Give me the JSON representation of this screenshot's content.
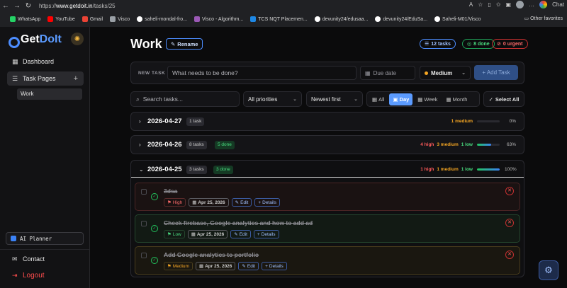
{
  "browser": {
    "url_prefix": "https://",
    "url_host": "www.getdoit.in",
    "url_path": "/tasks/25",
    "chat_label": "Chat",
    "bookmarks": [
      {
        "label": "WhatsApp",
        "color": "#25d366"
      },
      {
        "label": "YouTube",
        "color": "#ff0000"
      },
      {
        "label": "Gmail",
        "color": "#ea4335"
      },
      {
        "label": "Visco",
        "color": "#9aa0a6"
      },
      {
        "label": "saheli-mondal-fro...",
        "color": "#ffffff"
      },
      {
        "label": "Visco - Algorithm...",
        "color": "#9b59b6"
      },
      {
        "label": "TCS NQT Placemen...",
        "color": "#1e88e5"
      },
      {
        "label": "devunity24/edusaa...",
        "color": "#ffffff"
      },
      {
        "label": "devunity24/EduSa...",
        "color": "#ffffff"
      },
      {
        "label": "Saheli-M01/Visco",
        "color": "#ffffff"
      }
    ],
    "other_favorites": "Other favorites"
  },
  "sidebar": {
    "logo_get": "Get",
    "logo_doit": "DoIt",
    "dashboard": "Dashboard",
    "task_pages": "Task Pages",
    "active_page": "Work",
    "ai_planner": "AI Planner",
    "contact": "Contact",
    "logout": "Logout"
  },
  "header": {
    "title": "Work",
    "rename": "Rename",
    "stats": {
      "tasks": "12 tasks",
      "done": "8 done",
      "urgent": "0 urgent"
    }
  },
  "new_task": {
    "label": "NEW TASK",
    "placeholder": "What needs to be done?",
    "due_date": "Due date",
    "priority": "Medium",
    "add_button": "+ Add Task"
  },
  "filters": {
    "search_placeholder": "Search tasks...",
    "priority_filter": "All priorities",
    "sort": "Newest first",
    "views": [
      "All",
      "Day",
      "Week",
      "Month"
    ],
    "active_view": "Day",
    "select_all": "Select All"
  },
  "groups": [
    {
      "date": "2026-04-27",
      "count": "1 task",
      "done": "",
      "high": "",
      "medium": "1 medium",
      "low": "",
      "progress": 0,
      "pct": "0%"
    },
    {
      "date": "2026-04-26",
      "count": "8 tasks",
      "done": "5 done",
      "high": "4 high",
      "medium": "3 medium",
      "low": "1 low",
      "progress": 63,
      "pct": "63%"
    },
    {
      "date": "2026-04-25",
      "count": "3 tasks",
      "done": "3 done",
      "high": "1 high",
      "medium": "1 medium",
      "low": "1 low",
      "progress": 100,
      "pct": "100%"
    }
  ],
  "tasks": [
    {
      "title": "3dsa",
      "priority": "High",
      "date": "Apr 25, 2026",
      "edit": "Edit",
      "details": "Details"
    },
    {
      "title": "Check firebase, Google analytics and how to add ad",
      "priority": "Low",
      "date": "Apr 25, 2026",
      "edit": "Edit",
      "details": "Details"
    },
    {
      "title": "Add Google analytics to portfolio",
      "priority": "Medium",
      "date": "Apr 25, 2026",
      "edit": "Edit",
      "details": "Details"
    }
  ]
}
